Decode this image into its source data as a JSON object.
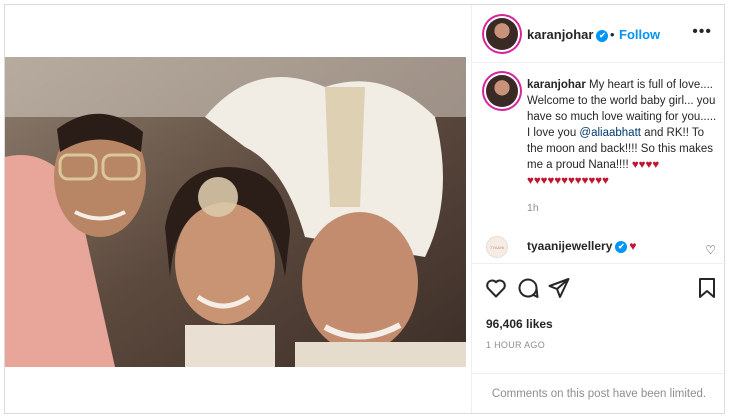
{
  "header": {
    "username": "karanjohar",
    "verified_mark": "✔",
    "separator": "•",
    "follow_label": "Follow",
    "more_label": "•••"
  },
  "caption": {
    "username": "karanjohar",
    "text_1": "My heart is full of love.... Welcome to the world baby girl... you have so much love waiting for you..... I love you ",
    "mention": "@aliaabhatt",
    "text_2": " and RK!! To the moon and back!!!! So this makes me a proud Nana!!!! ",
    "hearts_line1": "♥♥♥♥",
    "hearts_line2": "♥♥♥♥♥♥♥♥♥♥♥♥",
    "time": "1h"
  },
  "comment": {
    "username": "tyaanijewellery",
    "avatar_text": "TYAANI",
    "heart": "♥",
    "like_icon_glyph": "♡"
  },
  "actions": {
    "icons": [
      "heart-icon",
      "comment-icon",
      "share-icon",
      "bookmark-icon"
    ]
  },
  "stats": {
    "likes": "96,406 likes",
    "posted": "1 HOUR AGO"
  },
  "footer": {
    "limited_text": "Comments on this post have been limited."
  },
  "colors": {
    "accent": "#0095f6",
    "heart_red": "#c0152f",
    "muted": "#8e8e8e"
  }
}
